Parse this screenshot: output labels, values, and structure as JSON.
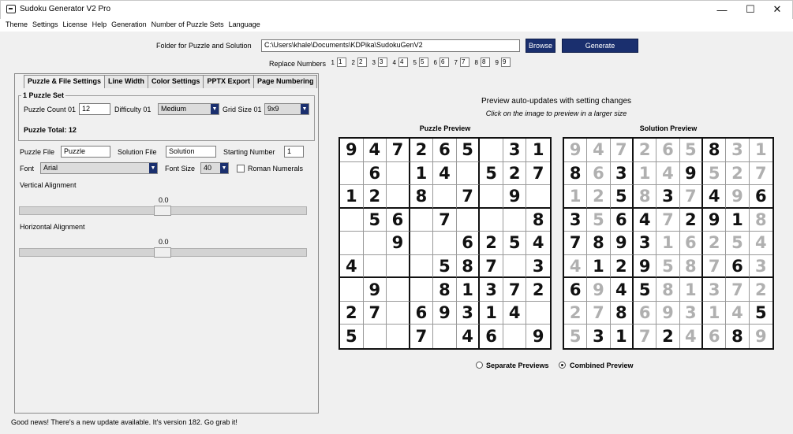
{
  "window": {
    "title": "Sudoku Generator V2 Pro",
    "min_glyph": "—",
    "max_glyph": "☐",
    "close_glyph": "✕"
  },
  "menu": [
    "Theme",
    "Settings",
    "License",
    "Help",
    "Generation",
    "Number of Puzzle Sets",
    "Language"
  ],
  "folder": {
    "label": "Folder for Puzzle and Solution",
    "value": "C:\\Users\\khale\\Documents\\KDPika\\SudokuGenV2",
    "browse_label": "Browse",
    "generate_label": "Generate"
  },
  "replace_numbers": {
    "label": "Replace Numbers",
    "items": [
      {
        "label": "1",
        "value": "1"
      },
      {
        "label": "2",
        "value": "2"
      },
      {
        "label": "3",
        "value": "3"
      },
      {
        "label": "4",
        "value": "4"
      },
      {
        "label": "5",
        "value": "5"
      },
      {
        "label": "6",
        "value": "6"
      },
      {
        "label": "7",
        "value": "7"
      },
      {
        "label": "8",
        "value": "8"
      },
      {
        "label": "9",
        "value": "9"
      }
    ]
  },
  "tabs": [
    "Puzzle & File Settings",
    "Line Width",
    "Color Settings",
    "PPTX Export",
    "Page Numbering"
  ],
  "puzzle_set": {
    "title": "1 Puzzle Set",
    "count_label": "Puzzle Count 01",
    "count_value": "12",
    "difficulty_label": "Difficulty 01",
    "difficulty_value": "Medium",
    "grid_label": "Grid Size 01",
    "grid_value": "9x9",
    "total_label": "Puzzle Total: 12"
  },
  "files": {
    "puzzle_file_label": "Puzzle File",
    "puzzle_file_value": "Puzzle",
    "solution_file_label": "Solution File",
    "solution_file_value": "Solution",
    "starting_number_label": "Starting Number",
    "starting_number_value": "1"
  },
  "font": {
    "label": "Font",
    "value": "Arial",
    "size_label": "Font Size",
    "size_value": "40",
    "roman_label": "Roman Numerals"
  },
  "vertical_alignment": {
    "label": "Vertical Alignment",
    "value_text": "0.0",
    "fraction": 0.5
  },
  "horizontal_alignment": {
    "label": "Horizontal Alignment",
    "value_text": "0.0",
    "fraction": 0.5
  },
  "preview": {
    "heading": "Preview auto-updates with setting changes",
    "subheading": "Click on the image to preview in a larger size",
    "puzzle_title": "Puzzle Preview",
    "solution_title": "Solution Preview",
    "puzzle_grid": [
      "9472 65 31",
      " 6 14 527",
      "12 8 7 9 ",
      " 56 7   8",
      "  9  6254",
      "4   587 3",
      " 9  81372",
      "27 69314 ",
      "5  7 46 9"
    ],
    "solution_grid": [
      "947265831",
      "863149527",
      "125837496",
      "356472918",
      "789316254",
      "412958763",
      "694581372",
      "278693145",
      "531724689"
    ],
    "solution_given_mask": [
      "000000100",
      "101001000",
      "001010101",
      "101101110",
      "111100000",
      "011100010",
      "101100000",
      "001000001",
      "011010010"
    ],
    "separate_label": "Separate Previews",
    "combined_label": "Combined Preview",
    "selected": "combined"
  },
  "status": "Good news! There's a new update available. It's version 182. Go grab it!"
}
